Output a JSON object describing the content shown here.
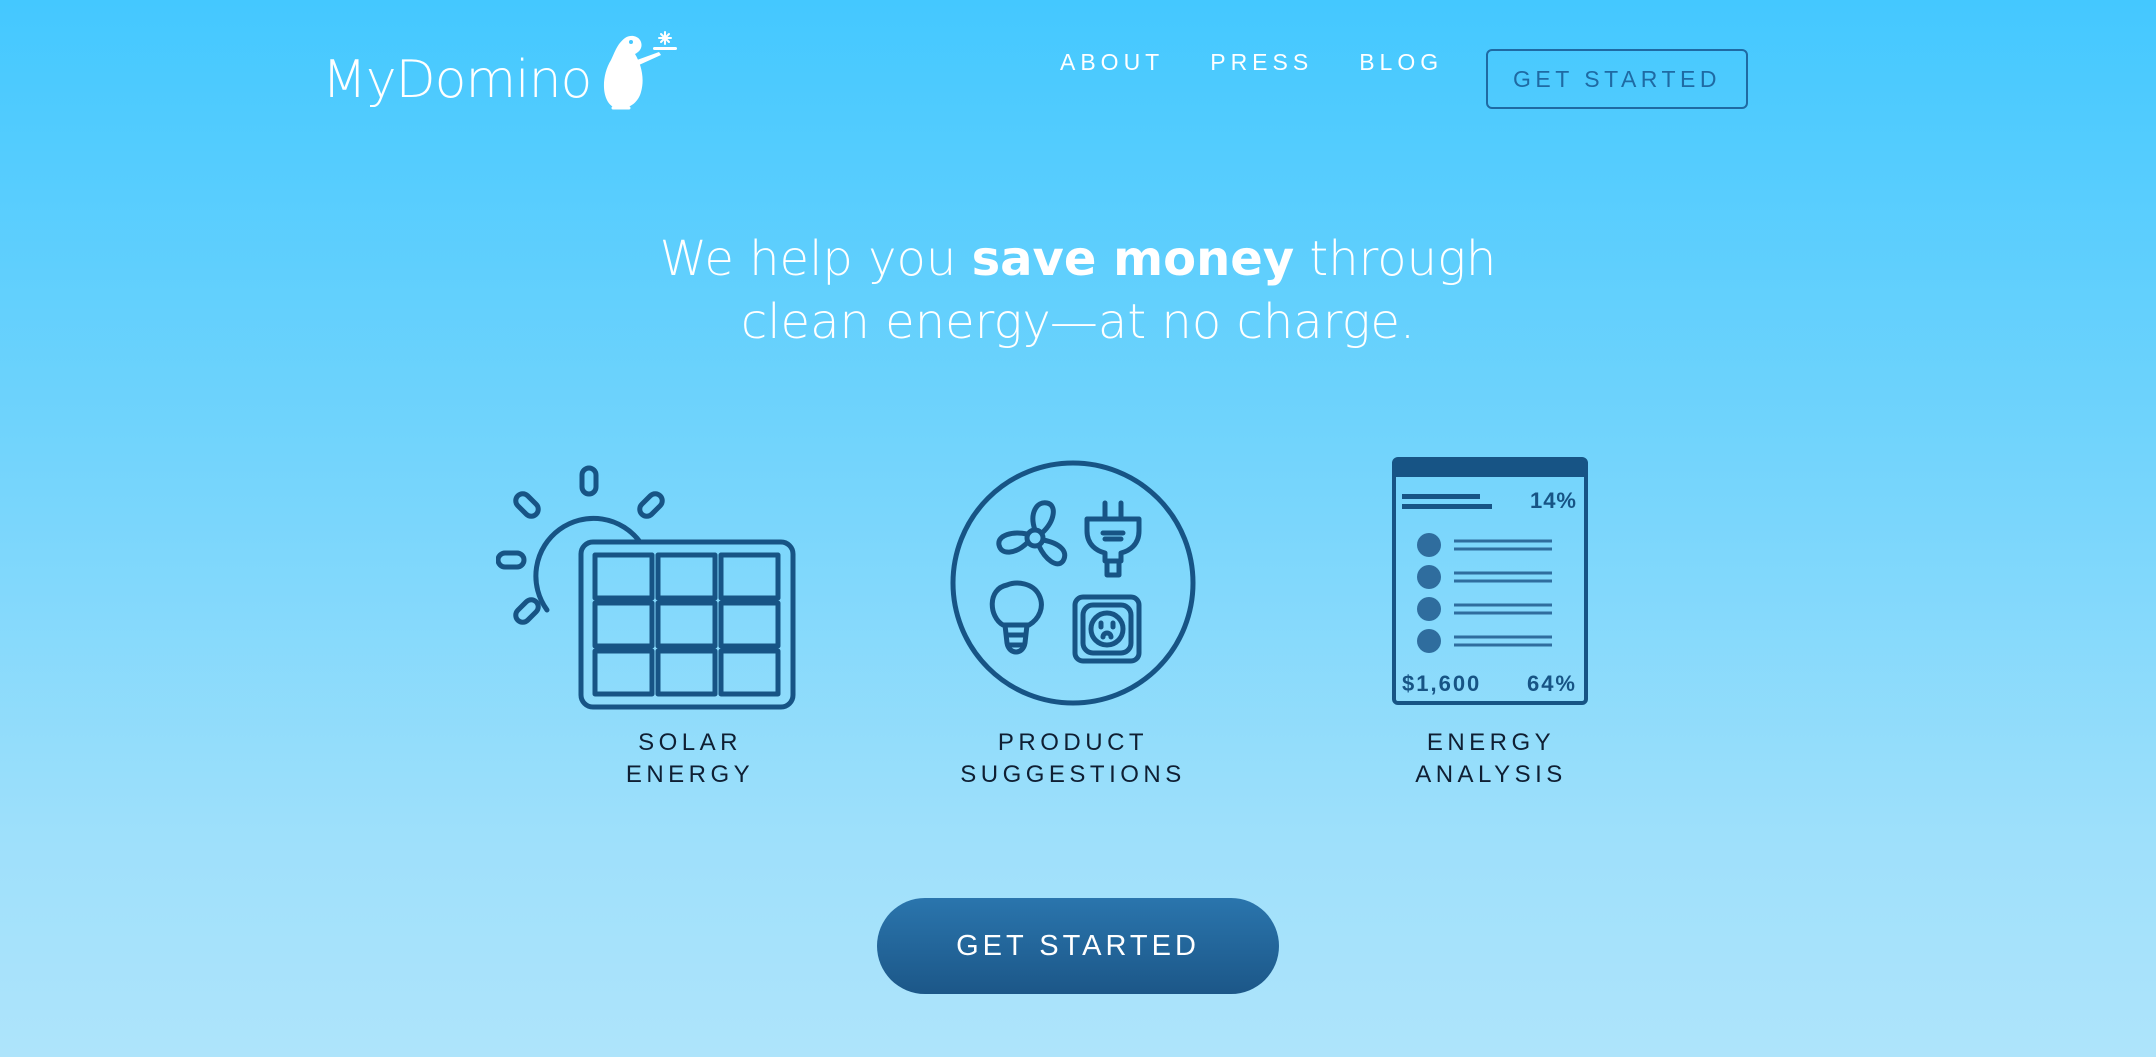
{
  "header": {
    "logo_text": "MyDomino",
    "nav": [
      {
        "label": "ABOUT"
      },
      {
        "label": "PRESS"
      },
      {
        "label": "BLOG"
      }
    ],
    "cta_label": "GET STARTED"
  },
  "hero": {
    "headline_pre": "We help you ",
    "headline_bold": "save money",
    "headline_post": " through",
    "headline_line2": "clean energy—at no charge."
  },
  "features": [
    {
      "label_line1": "SOLAR",
      "label_line2": "ENERGY",
      "icon": "solar-panel-icon"
    },
    {
      "label_line1": "PRODUCT",
      "label_line2": "SUGGESTIONS",
      "icon": "products-icon"
    },
    {
      "label_line1": "ENERGY",
      "label_line2": "ANALYSIS",
      "icon": "report-icon"
    }
  ],
  "report": {
    "percent_top": "14%",
    "amount": "$1,600",
    "percent_bottom": "64%"
  },
  "main_cta_label": "GET STARTED",
  "colors": {
    "background_top": "#44c8ff",
    "background_bottom": "#aee4fb",
    "icon_stroke": "#175485",
    "cta": "#22679d",
    "text_white": "#ffffff"
  }
}
